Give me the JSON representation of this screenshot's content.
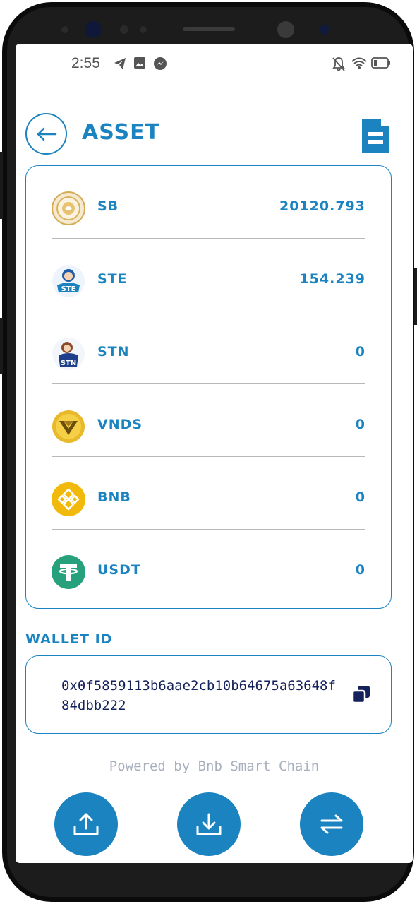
{
  "status_bar": {
    "time": "2:55",
    "left_icons": [
      "telegram-icon",
      "image-icon",
      "messenger-icon"
    ],
    "right_icons": [
      "notifications-off-icon",
      "wifi-icon",
      "battery-icon"
    ]
  },
  "header": {
    "title": "ASSET",
    "back_icon": "arrow-left-icon",
    "menu_icon": "document-icon"
  },
  "assets": [
    {
      "symbol": "SB",
      "value": "20120.793",
      "logo": "sb-coin-logo"
    },
    {
      "symbol": "STE",
      "value": "154.239",
      "logo": "ste-logo"
    },
    {
      "symbol": "STN",
      "value": "0",
      "logo": "stn-logo"
    },
    {
      "symbol": "VNDS",
      "value": "0",
      "logo": "vnds-logo"
    },
    {
      "symbol": "BNB",
      "value": "0",
      "logo": "bnb-logo"
    },
    {
      "symbol": "USDT",
      "value": "0",
      "logo": "usdt-logo"
    }
  ],
  "wallet": {
    "label": "WALLET ID",
    "address": "0x0f5859113b6aae2cb10b64675a63648f84dbb222",
    "copy_icon": "copy-icon"
  },
  "footer": {
    "powered_by": "Powered by Bnb Smart Chain"
  },
  "actions": [
    {
      "name": "send",
      "icon": "upload-icon"
    },
    {
      "name": "receive",
      "icon": "download-icon"
    },
    {
      "name": "swap",
      "icon": "swap-icon"
    }
  ],
  "colors": {
    "accent": "#1b83c0",
    "address_text": "#15215a",
    "muted": "#a8b0be"
  }
}
